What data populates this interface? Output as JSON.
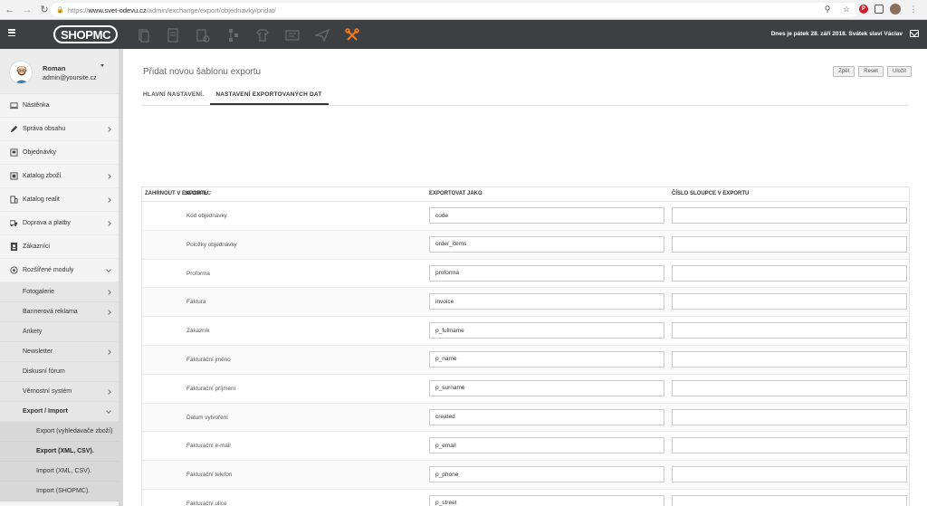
{
  "browser": {
    "url_protocol": "https://",
    "url_host": "www.svet-odevu.cz",
    "url_path": "/admin/exchange/export/objednavky/pridat/"
  },
  "topbar": {
    "logo_text": "SHOPMC",
    "date_text": "Dnes je pátek 28. září 2018. Svátek slaví Václav"
  },
  "profile": {
    "name": "Roman",
    "email": "admin@yoursite.cz"
  },
  "sidebar": {
    "items": [
      {
        "label": "Nástěnka",
        "icon": "laptop-icon",
        "chevron": false
      },
      {
        "label": "Správa obsahu",
        "icon": "pencil-icon",
        "chevron": true
      },
      {
        "label": "Objednávky",
        "icon": "order-icon",
        "chevron": false
      },
      {
        "label": "Katalog zboží",
        "icon": "catalog-icon",
        "chevron": true
      },
      {
        "label": "Katalog realit",
        "icon": "building-icon",
        "chevron": true
      },
      {
        "label": "Doprava a platby",
        "icon": "truck-icon",
        "chevron": true
      },
      {
        "label": "Zákazníci",
        "icon": "customer-icon",
        "chevron": false
      },
      {
        "label": "Rozšířené moduly",
        "icon": "modules-icon",
        "chevron": "down"
      }
    ],
    "submenu": [
      {
        "label": "Fotogalerie",
        "chevron": true
      },
      {
        "label": "Bannerová reklama",
        "chevron": true
      },
      {
        "label": "Ankety",
        "chevron": false
      },
      {
        "label": "Newsletter",
        "chevron": true
      },
      {
        "label": "Diskusní fórum",
        "chevron": false
      },
      {
        "label": "Věrnostní systém",
        "chevron": true
      },
      {
        "label": "Export / Import",
        "chevron": "down"
      }
    ],
    "subsub": [
      {
        "label": "Export (vyhledavače zboží)",
        "active": false
      },
      {
        "label": "Export (XML, CSV).",
        "active": true
      },
      {
        "label": "Import (XML, CSV).",
        "active": false
      },
      {
        "label": "Import (SHOPMC).",
        "active": false
      }
    ]
  },
  "main": {
    "title": "Přidat novou šablonu exportu",
    "buttons": {
      "back": "Zpět",
      "reset": "Reset",
      "save": "Uložit"
    },
    "tabs": [
      "HLAVNÍ NASTAVENÍ.",
      "NASTAVENÍ EXPORTOVANÝCH DAT"
    ],
    "table_headers": [
      "ZAHRNOUT V EXPORTU",
      "EXPORTOVAT JAKO",
      "ČÍSLO SLOUPCE V EXPORTU"
    ],
    "table_header_overlap": "SLOUPEC",
    "rows": [
      {
        "field": "Kód objednávky",
        "export_as": "code"
      },
      {
        "field": "Položky objednávky",
        "export_as": "order_items"
      },
      {
        "field": "Proforma",
        "export_as": "proforma"
      },
      {
        "field": "Faktura",
        "export_as": "invoice"
      },
      {
        "field": "Zákazník",
        "export_as": "p_fullname"
      },
      {
        "field": "Fakturační jméno",
        "export_as": "p_name"
      },
      {
        "field": "Fakturační příjmení",
        "export_as": "p_surname"
      },
      {
        "field": "Datum vytvoření",
        "export_as": "created"
      },
      {
        "field": "Fakturační e-mail",
        "export_as": "p_email"
      },
      {
        "field": "Fakturační telefon",
        "export_as": "p_phone"
      },
      {
        "field": "Fakturační ulice",
        "export_as": "p_street"
      }
    ]
  }
}
